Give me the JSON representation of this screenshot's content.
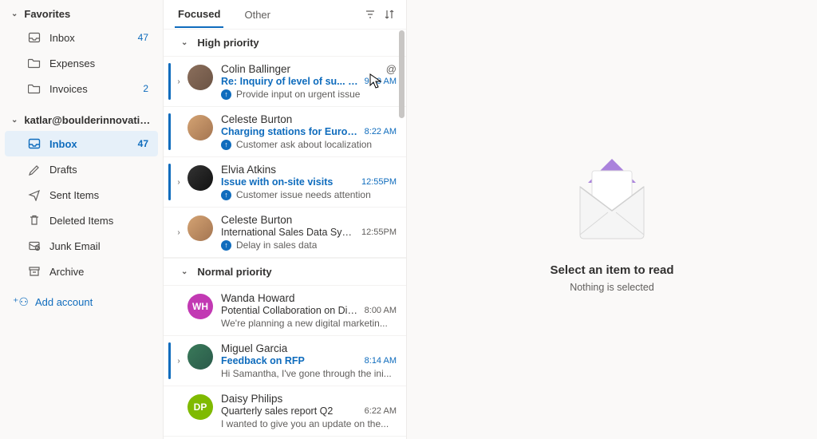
{
  "nav": {
    "favorites_label": "Favorites",
    "favorites": [
      {
        "icon": "inbox",
        "label": "Inbox",
        "count": "47"
      },
      {
        "icon": "folder",
        "label": "Expenses",
        "count": ""
      },
      {
        "icon": "folder",
        "label": "Invoices",
        "count": "2"
      }
    ],
    "account_label": "katlar@boulderinnovatio...",
    "folders": [
      {
        "icon": "inbox",
        "label": "Inbox",
        "count": "47",
        "selected": true
      },
      {
        "icon": "drafts",
        "label": "Drafts",
        "count": ""
      },
      {
        "icon": "sent",
        "label": "Sent Items",
        "count": ""
      },
      {
        "icon": "trash",
        "label": "Deleted Items",
        "count": ""
      },
      {
        "icon": "junk",
        "label": "Junk Email",
        "count": ""
      },
      {
        "icon": "archive",
        "label": "Archive",
        "count": ""
      }
    ],
    "add_account": "Add account"
  },
  "list": {
    "tabs": {
      "focused": "Focused",
      "other": "Other"
    },
    "groups": {
      "high": "High priority",
      "normal": "Normal priority"
    },
    "messages": {
      "m1": {
        "sender": "Colin Ballinger",
        "subject": "Re: Inquiry of level of su... (2)",
        "time": "9:30 AM",
        "preview": "Provide input on urgent issue",
        "at": "@"
      },
      "m2": {
        "sender": "Celeste Burton",
        "subject": "Charging stations for Europ...",
        "time": "8:22 AM",
        "preview": "Customer ask about localization"
      },
      "m3": {
        "sender": "Elvia Atkins",
        "subject": "Issue with on-site visits",
        "time": "12:55PM",
        "preview": "Customer issue needs attention"
      },
      "m4": {
        "sender": "Celeste Burton",
        "subject": "International Sales Data Sync D...",
        "time": "12:55PM",
        "preview": "Delay in sales data"
      },
      "m5": {
        "sender": "Wanda Howard",
        "initials": "WH",
        "subject": "Potential Collaboration on Digit...",
        "time": "8:00 AM",
        "preview": "We're planning a new digital marketin..."
      },
      "m6": {
        "sender": "Miguel Garcia",
        "subject": "Feedback on RFP",
        "time": "8:14 AM",
        "preview": "Hi Samantha, I've gone through the ini..."
      },
      "m7": {
        "sender": "Daisy Philips",
        "initials": "DP",
        "subject": "Quarterly sales report Q2",
        "time": "6:22 AM",
        "preview": "I wanted to give you an update on the..."
      }
    }
  },
  "reading": {
    "title": "Select an item to read",
    "subtitle": "Nothing is selected"
  }
}
